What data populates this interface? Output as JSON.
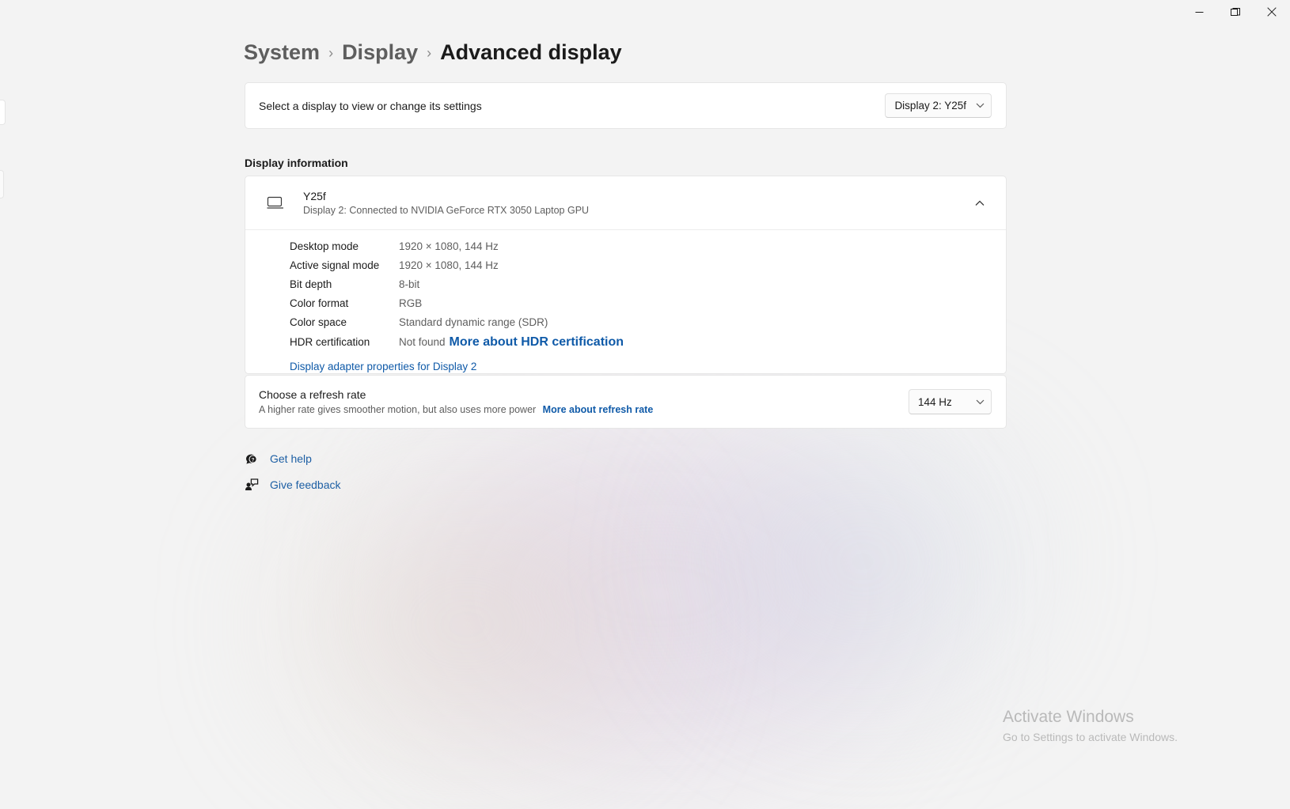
{
  "window": {
    "controls": [
      {
        "name": "minimize",
        "glyph": "minimize-icon"
      },
      {
        "name": "restore",
        "glyph": "restore-icon"
      },
      {
        "name": "close",
        "glyph": "close-icon"
      }
    ]
  },
  "breadcrumb": {
    "items": [
      {
        "label": "System",
        "current": false
      },
      {
        "label": "Display",
        "current": false
      },
      {
        "label": "Advanced display",
        "current": true
      }
    ],
    "separator": "›"
  },
  "display_selector": {
    "label": "Select a display to view or change its settings",
    "selected": "Display 2: Y25f"
  },
  "display_information": {
    "section_title": "Display information",
    "monitor_name": "Y25f",
    "monitor_sub": "Display 2: Connected to NVIDIA GeForce RTX 3050 Laptop GPU",
    "expanded": true,
    "rows": [
      {
        "key": "Desktop mode",
        "value": "1920 × 1080, 144 Hz"
      },
      {
        "key": "Active signal mode",
        "value": "1920 × 1080, 144 Hz"
      },
      {
        "key": "Bit depth",
        "value": "8-bit"
      },
      {
        "key": "Color format",
        "value": "RGB"
      },
      {
        "key": "Color space",
        "value": "Standard dynamic range (SDR)"
      },
      {
        "key": "HDR certification",
        "value": "Not found",
        "link": "More about HDR certification"
      }
    ],
    "adapter_link": "Display adapter properties for Display 2"
  },
  "refresh_rate": {
    "title": "Choose a refresh rate",
    "description": "A higher rate gives smoother motion, but also uses more power",
    "link": "More about refresh rate",
    "selected": "144 Hz"
  },
  "bottom_links": [
    {
      "label": "Get help",
      "icon": "help-icon"
    },
    {
      "label": "Give feedback",
      "icon": "feedback-icon"
    }
  ],
  "watermark": {
    "title": "Activate Windows",
    "subtitle": "Go to Settings to activate Windows."
  },
  "colors": {
    "page_background": "#f3f3f3",
    "card_background": "#ffffff",
    "accent_link": "#0f5aa8",
    "text_primary": "#1b1b1b",
    "text_secondary": "#5e5e5e",
    "close_hover": "#c42b1c"
  }
}
